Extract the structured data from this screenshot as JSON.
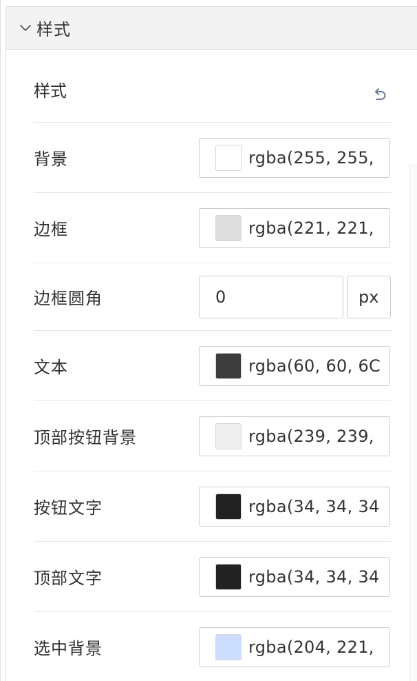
{
  "section": {
    "title": "样式"
  },
  "style_row": {
    "label": "样式",
    "reset_icon": "undo-icon"
  },
  "fields": [
    {
      "label": "背景",
      "value": "rgba(255, 255,",
      "swatch": "#ffffff"
    },
    {
      "label": "边框",
      "value": "rgba(221, 221,",
      "swatch": "#dddddd"
    },
    {
      "label": "文本",
      "value": "rgba(60, 60, 6C",
      "swatch": "#3c3c3c"
    },
    {
      "label": "顶部按钮背景",
      "value": "rgba(239, 239,",
      "swatch": "#efefef"
    },
    {
      "label": "按钮文字",
      "value": "rgba(34, 34, 34",
      "swatch": "#222222"
    },
    {
      "label": "顶部文字",
      "value": "rgba(34, 34, 34",
      "swatch": "#222222"
    },
    {
      "label": "选中背景",
      "value": "rgba(204, 221,",
      "swatch": "#ccddff"
    }
  ],
  "radius": {
    "label": "边框圆角",
    "value": "0",
    "unit": "px"
  }
}
